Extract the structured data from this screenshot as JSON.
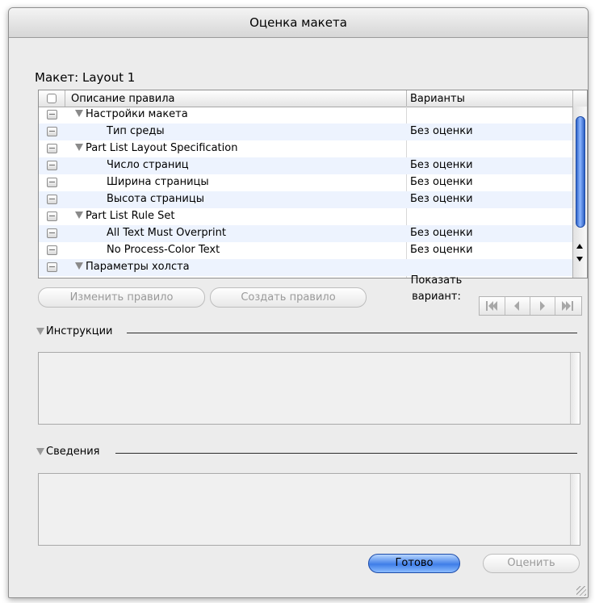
{
  "window": {
    "title": "Оценка макета"
  },
  "layout_label": "Макет: Layout 1",
  "table": {
    "headers": {
      "description": "Описание правила",
      "variants": "Варианты"
    },
    "rows": [
      {
        "desc": "Настройки макета",
        "variant": "",
        "group": true
      },
      {
        "desc": "Тип среды",
        "variant": "Без оценки",
        "group": false
      },
      {
        "desc": "Part List Layout Specification",
        "variant": "",
        "group": true
      },
      {
        "desc": "Число страниц",
        "variant": "Без оценки",
        "group": false
      },
      {
        "desc": "Ширина страницы",
        "variant": "Без оценки",
        "group": false
      },
      {
        "desc": "Высота страницы",
        "variant": "Без оценки",
        "group": false
      },
      {
        "desc": "Part List Rule Set",
        "variant": "",
        "group": true
      },
      {
        "desc": "All Text Must Overprint",
        "variant": "Без оценки",
        "group": false
      },
      {
        "desc": "No Process-Color Text",
        "variant": "Без оценки",
        "group": false
      },
      {
        "desc": "Параметры холста",
        "variant": "",
        "group": true
      }
    ]
  },
  "buttons": {
    "edit_rule": "Изменить правило",
    "create_rule": "Создать правило",
    "done": "Готово",
    "evaluate": "Оценить"
  },
  "show_variant": {
    "line1": "Показать",
    "line2": "вариант:"
  },
  "sections": {
    "instructions": "Инструкции",
    "info": "Сведения"
  },
  "icons": [
    "checkbox-icon",
    "disclosure-triangle-icon",
    "first-icon",
    "prev-icon",
    "next-icon",
    "last-icon",
    "resize-grip-icon"
  ]
}
